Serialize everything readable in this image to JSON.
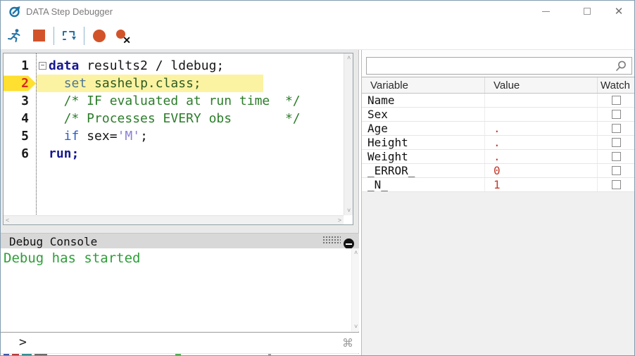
{
  "window": {
    "title": "DATA Step Debugger"
  },
  "icons": {
    "close": "✕",
    "command": "⌘",
    "collapse_minus": "−",
    "scroll_up": "˄",
    "scroll_down": "˅",
    "scroll_left": "˂",
    "scroll_right": "˃"
  },
  "toolbar": {
    "buttons": [
      {
        "id": "run",
        "icon": "runner-icon"
      },
      {
        "id": "stop",
        "icon": "stop-square-icon"
      },
      {
        "id": "step",
        "icon": "step-over-icon"
      },
      {
        "id": "toggle-breakpoint",
        "icon": "breakpoint-circle-icon"
      },
      {
        "id": "clear-breakpoints",
        "icon": "clear-breakpoints-icon"
      }
    ]
  },
  "search": {
    "value": ""
  },
  "editor": {
    "lines": [
      {
        "number": "1",
        "current": false,
        "collapse": true,
        "highlight": false,
        "segments": [
          [
            "data",
            "kw"
          ],
          [
            " results2 / ldebug;",
            "plain"
          ]
        ]
      },
      {
        "number": "2",
        "current": true,
        "collapse": false,
        "highlight": true,
        "segments": [
          [
            "  ",
            "plain"
          ],
          [
            "set",
            "setkw"
          ],
          [
            " ",
            "plain"
          ],
          [
            "sashelp.class;",
            "ds"
          ]
        ]
      },
      {
        "number": "3",
        "current": false,
        "collapse": false,
        "highlight": false,
        "segments": [
          [
            "  /* IF evaluated at run time  */",
            "comment"
          ]
        ]
      },
      {
        "number": "4",
        "current": false,
        "collapse": false,
        "highlight": false,
        "segments": [
          [
            "  /* Processes EVERY obs       */",
            "comment"
          ]
        ]
      },
      {
        "number": "5",
        "current": false,
        "collapse": false,
        "highlight": false,
        "segments": [
          [
            "  ",
            "plain"
          ],
          [
            "if",
            "ifkw"
          ],
          [
            " sex=",
            "plain"
          ],
          [
            "'M'",
            "str"
          ],
          [
            ";",
            "plain"
          ]
        ]
      },
      {
        "number": "6",
        "current": false,
        "collapse": false,
        "highlight": false,
        "segments": [
          [
            "run;",
            "kw"
          ]
        ]
      }
    ]
  },
  "watch_table": {
    "columns": [
      "Variable",
      "Value",
      "Watch"
    ],
    "rows": [
      {
        "variable": "Name",
        "value": ""
      },
      {
        "variable": "Sex",
        "value": ""
      },
      {
        "variable": "Age",
        "value": "."
      },
      {
        "variable": "Height",
        "value": "."
      },
      {
        "variable": "Weight",
        "value": "."
      },
      {
        "variable": "_ERROR_",
        "value": "0"
      },
      {
        "variable": "_N_",
        "value": "1"
      }
    ]
  },
  "console": {
    "title": "Debug Console",
    "output": "Debug has started",
    "prompt": ">"
  },
  "colors": {
    "accent_orange": "#d2532a",
    "icon_blue": "#2172a4",
    "keyword_navy": "#16188f",
    "comment_green": "#2c7d2a",
    "console_green": "#2e9e38",
    "value_red": "#c23a2b",
    "highlight_yellow": "#fcf3a2",
    "badge_yellow": "#ffdf2f",
    "title_gray": "#7b7b7b"
  }
}
